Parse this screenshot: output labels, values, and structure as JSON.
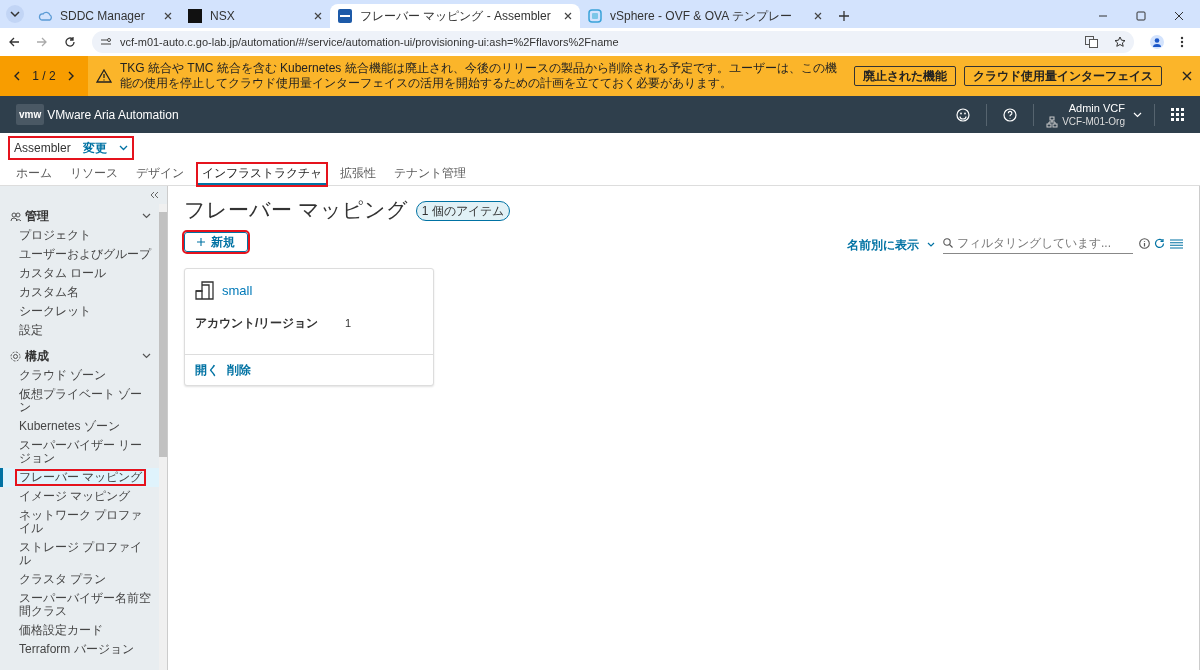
{
  "browser": {
    "tabs": [
      {
        "title": "SDDC Manager",
        "selected": false
      },
      {
        "title": "NSX",
        "selected": false
      },
      {
        "title": "フレーバー マッピング - Assembler",
        "selected": true
      },
      {
        "title": "vSphere - OVF & OVA テンプレー",
        "selected": false
      }
    ],
    "url": "vcf-m01-auto.c.go-lab.jp/automation/#/service/automation-ui/provisioning-ui:ash=%2Fflavors%2Fname"
  },
  "banner": {
    "pager": "1 / 2",
    "message": "TKG 統合や TMC 統合を含む Kubernetes 統合機能は廃止され、今後のリリースの製品から削除される予定です。ユーザーは、この機能の使用を停止してクラウド使用量インターフェイスの活用を開始するための計画を立てておく必要があります。",
    "buttons": [
      "廃止された機能",
      "クラウド使用量インターフェイス"
    ]
  },
  "header": {
    "logo": "vmw",
    "product": "VMware Aria Automation",
    "user": "Admin VCF",
    "org": "VCF-M01-Org"
  },
  "app": {
    "name": "Assembler",
    "change": "変更",
    "highlighted": true
  },
  "nav_tabs": [
    {
      "label": "ホーム",
      "selected": false,
      "highlighted": false
    },
    {
      "label": "リソース",
      "selected": false,
      "highlighted": false
    },
    {
      "label": "デザイン",
      "selected": false,
      "highlighted": false
    },
    {
      "label": "インフラストラクチャ",
      "selected": true,
      "highlighted": true
    },
    {
      "label": "拡張性",
      "selected": false,
      "highlighted": false
    },
    {
      "label": "テナント管理",
      "selected": false,
      "highlighted": false
    }
  ],
  "sidebar": {
    "groups": [
      {
        "label": "管理",
        "expanded": true,
        "children": [
          {
            "label": "プロジェクト",
            "selected": false,
            "highlighted": false
          },
          {
            "label": "ユーザーおよびグループ",
            "selected": false,
            "highlighted": false
          },
          {
            "label": "カスタム ロール",
            "selected": false,
            "highlighted": false
          },
          {
            "label": "カスタム名",
            "selected": false,
            "highlighted": false
          },
          {
            "label": "シークレット",
            "selected": false,
            "highlighted": false
          },
          {
            "label": "設定",
            "selected": false,
            "highlighted": false
          }
        ]
      },
      {
        "label": "構成",
        "expanded": true,
        "children": [
          {
            "label": "クラウド ゾーン",
            "selected": false,
            "highlighted": false
          },
          {
            "label": "仮想プライベート ゾーン",
            "selected": false,
            "highlighted": false
          },
          {
            "label": "Kubernetes ゾーン",
            "selected": false,
            "highlighted": false
          },
          {
            "label": "スーパーバイザー リージョン",
            "selected": false,
            "highlighted": false
          },
          {
            "label": "フレーバー マッピング",
            "selected": true,
            "highlighted": true
          },
          {
            "label": "イメージ マッピング",
            "selected": false,
            "highlighted": false
          },
          {
            "label": "ネットワーク プロファイル",
            "selected": false,
            "highlighted": false
          },
          {
            "label": "ストレージ プロファイル",
            "selected": false,
            "highlighted": false
          },
          {
            "label": "クラスタ プラン",
            "selected": false,
            "highlighted": false
          },
          {
            "label": "スーパーバイザー名前空間クラス",
            "selected": false,
            "highlighted": false
          },
          {
            "label": "価格設定カード",
            "selected": false,
            "highlighted": false
          },
          {
            "label": "Terraform バージョン",
            "selected": false,
            "highlighted": false
          }
        ]
      }
    ]
  },
  "page": {
    "title": "フレーバー マッピング",
    "count": "1 個のアイテム",
    "new_button": {
      "label": "新規",
      "highlighted": true
    },
    "sort": "名前別に表示",
    "filter_placeholder": "フィルタリングしています...",
    "cards": [
      {
        "name": "small",
        "field_label": "アカウント/リージョン",
        "field_value": "1",
        "actions": [
          "開く",
          "削除"
        ]
      }
    ]
  }
}
